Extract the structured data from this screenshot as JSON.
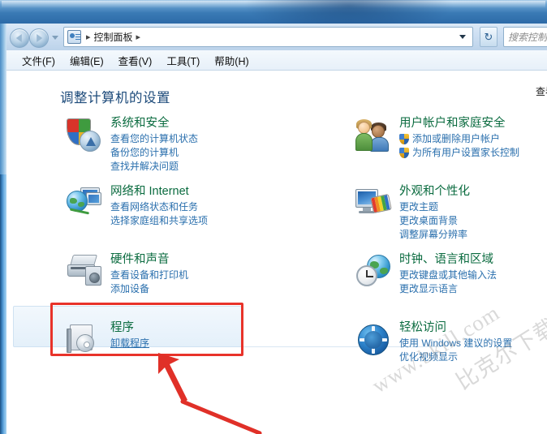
{
  "window": {
    "title": "",
    "address": {
      "icon": "control-panel-icon",
      "crumb": "控制面板",
      "separator": "▸",
      "refresh_label": "↻"
    },
    "search": {
      "placeholder": "搜索控制面板"
    },
    "nav": {
      "back_label": "后退",
      "forward_label": "前进",
      "recent_label": "最近浏览的位置"
    }
  },
  "menubar": {
    "items": [
      {
        "label": "文件(F)"
      },
      {
        "label": "编辑(E)"
      },
      {
        "label": "查看(V)"
      },
      {
        "label": "工具(T)"
      },
      {
        "label": "帮助(H)"
      }
    ]
  },
  "content": {
    "page_title": "调整计算机的设置",
    "view_by": "查看方式:"
  },
  "categories_left": [
    {
      "icon": "security-shield-icon",
      "title": "系统和安全",
      "links": [
        {
          "label": "查看您的计算机状态",
          "shield": false
        },
        {
          "label": "备份您的计算机",
          "shield": false
        },
        {
          "label": "查找并解决问题",
          "shield": false
        }
      ]
    },
    {
      "icon": "network-globe-icon",
      "title": "网络和 Internet",
      "links": [
        {
          "label": "查看网络状态和任务",
          "shield": false
        },
        {
          "label": "选择家庭组和共享选项",
          "shield": false
        }
      ]
    },
    {
      "icon": "printer-speaker-icon",
      "title": "硬件和声音",
      "links": [
        {
          "label": "查看设备和打印机",
          "shield": false
        },
        {
          "label": "添加设备",
          "shield": false
        }
      ]
    },
    {
      "icon": "programs-cd-icon",
      "title": "程序",
      "links": [
        {
          "label": "卸载程序",
          "shield": false,
          "underlined": true
        }
      ]
    }
  ],
  "categories_right": [
    {
      "icon": "users-icon",
      "title": "用户帐户和家庭安全",
      "links": [
        {
          "label": "添加或删除用户帐户",
          "shield": true
        },
        {
          "label": "为所有用户设置家长控制",
          "shield": true
        }
      ]
    },
    {
      "icon": "appearance-monitor-icon",
      "title": "外观和个性化",
      "links": [
        {
          "label": "更改主题",
          "shield": false
        },
        {
          "label": "更改桌面背景",
          "shield": false
        },
        {
          "label": "调整屏幕分辨率",
          "shield": false
        }
      ]
    },
    {
      "icon": "clock-globe-icon",
      "title": "时钟、语言和区域",
      "links": [
        {
          "label": "更改键盘或其他输入法",
          "shield": false
        },
        {
          "label": "更改显示语言",
          "shield": false
        }
      ]
    },
    {
      "icon": "ease-of-access-icon",
      "title": "轻松访问",
      "links": [
        {
          "label": "使用 Windows 建议的设置",
          "shield": false
        },
        {
          "label": "优化视频显示",
          "shield": false
        }
      ]
    }
  ],
  "annotations": {
    "highlight_target": "程序",
    "arrow_color": "#e8332a",
    "box_color": "#e8332a"
  },
  "watermark": {
    "line1": "www.bkill.com",
    "line2": "比克尔下载"
  },
  "colors": {
    "category_title": "#0a6b3f",
    "link": "#2a6fad",
    "page_title": "#1c4a7a",
    "aero_blue": "#2f6fae",
    "annotation_red": "#e8332a"
  }
}
